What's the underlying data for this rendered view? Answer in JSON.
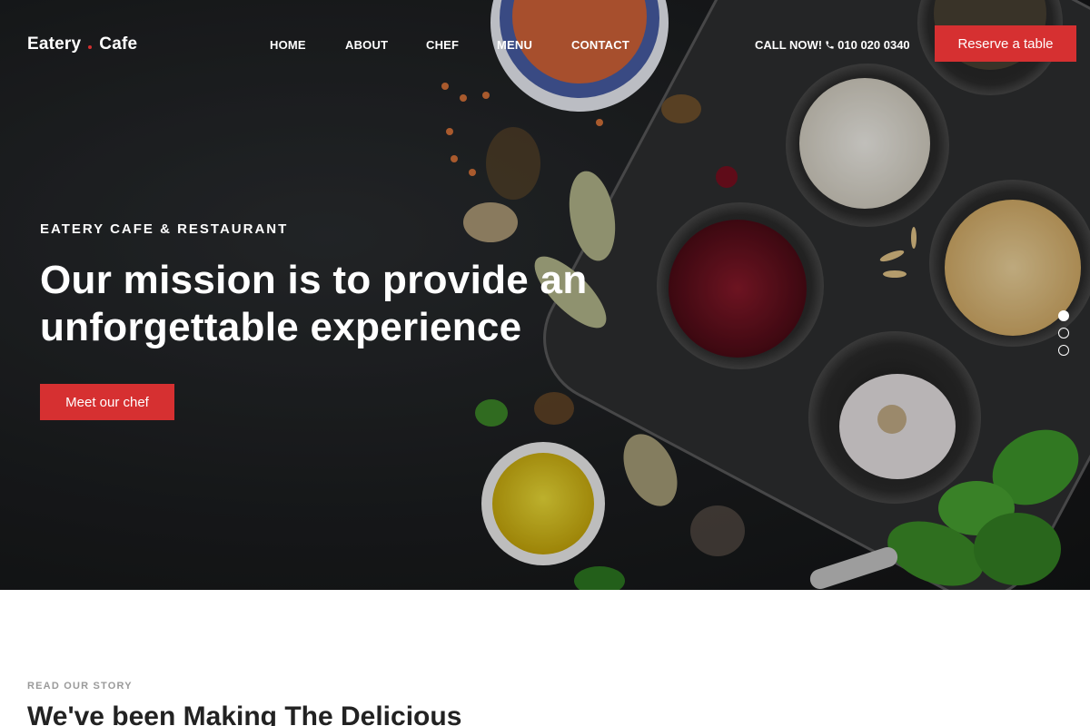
{
  "header": {
    "brand_left": "Eatery",
    "brand_right": "Cafe",
    "nav": [
      "HOME",
      "ABOUT",
      "CHEF",
      "MENU",
      "CONTACT"
    ],
    "call_label": "CALL NOW!",
    "phone": "010 020 0340",
    "reserve_label": "Reserve a table"
  },
  "hero": {
    "eyebrow": "EATERY CAFE & RESTAURANT",
    "headline_line1": "Our mission is to provide an",
    "headline_line2": "unforgettable experience",
    "cta_label": "Meet our chef",
    "slides": 3,
    "active_slide": 1
  },
  "story": {
    "eyebrow": "READ OUR STORY",
    "title": "We've been Making The Delicious"
  },
  "colors": {
    "accent": "#d63031",
    "hero_bg": "#1c1e20"
  }
}
